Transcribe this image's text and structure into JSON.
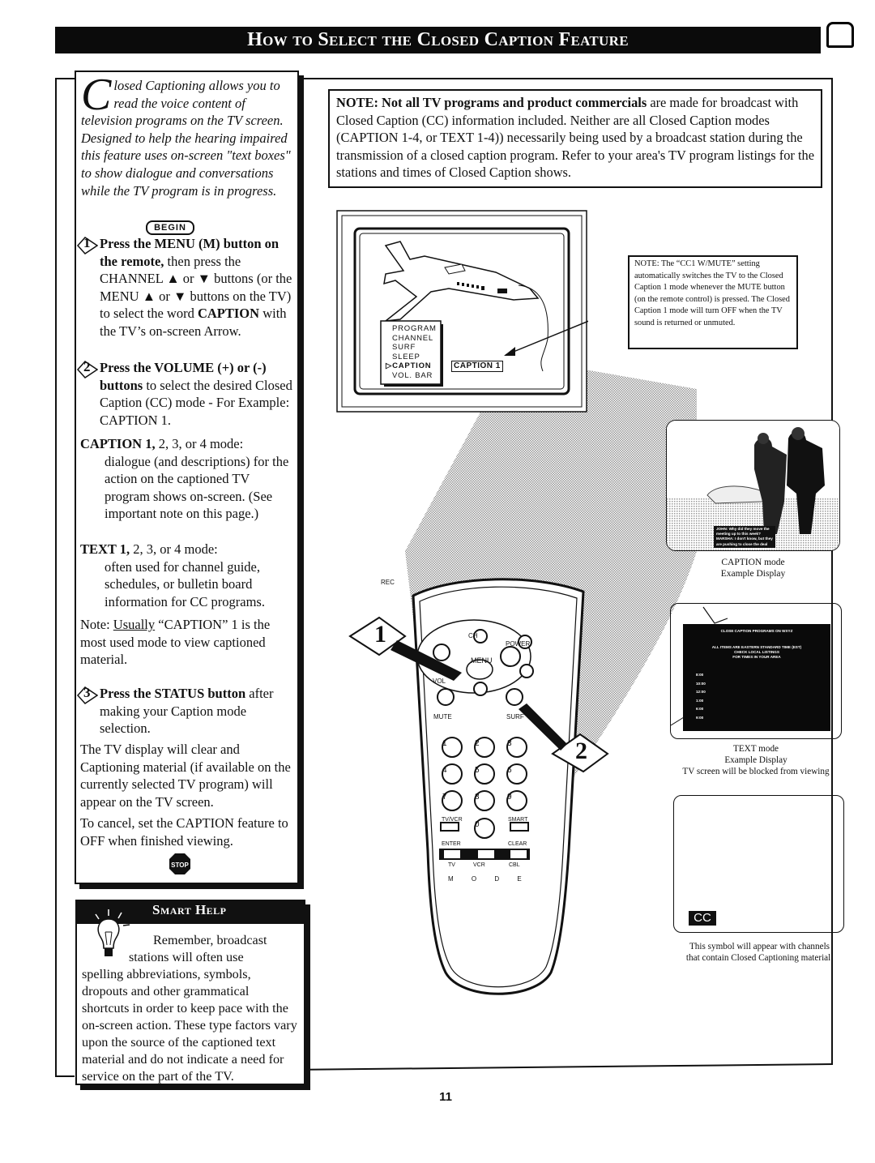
{
  "header": {
    "title": "How to Select the Closed Caption Feature",
    "icon": "tv-icon"
  },
  "intro": {
    "dropcap": "C",
    "text": "losed Captioning allows you to read the voice content of television programs on the TV screen. Designed to help the hearing impaired this feature uses on-screen \"text boxes\" to show dialogue and conversations while the TV program is in progress."
  },
  "begin_label": "BEGIN",
  "steps": [
    {
      "number": "1",
      "bold": "Press the MENU (M) button on the remote,",
      "text": " then press the CHANNEL ▲ or ▼ buttons (or the MENU ▲ or ▼ buttons on the TV) to select the word ",
      "bold2": "CAPTION",
      "text2": " with the TV’s on-screen Arrow."
    },
    {
      "number": "2",
      "bold": "Press the VOLUME (+) or (-) buttons",
      "text": " to select the desired Closed Caption (CC) mode - For Example: CAPTION 1."
    },
    {
      "number": "3",
      "bold": "Press the STATUS button",
      "text": " after making your Caption mode selection."
    }
  ],
  "modes": {
    "caption": {
      "title_bold": "CAPTION 1,",
      "title_rest": " 2, 3, or 4 mode:",
      "desc": "dialogue (and descriptions) for the action on the captioned TV program shows on-screen. (See important note on this page.)"
    },
    "text": {
      "title_bold": "TEXT 1,",
      "title_rest": " 2, 3, or 4 mode:",
      "desc": "often used for channel guide, schedules, or bulletin board information for CC programs."
    }
  },
  "usual_note": {
    "prefix": "Note: ",
    "underlined": "Usually",
    "rest": " “CAPTION” 1 is the most used mode to view captioned material."
  },
  "clear_note": "The TV display will clear and Captioning material  (if available on the currently selected TV program) will appear on the TV screen.",
  "cancel_note": "To cancel, set the CAPTION feature to OFF when finished viewing.",
  "stop_label": "STOP",
  "smart_help": {
    "title": "Smart Help",
    "line1": "Remember, broadcast",
    "line2": "stations will often use",
    "rest": "spelling abbreviations, symbols, dropouts and other grammatical shortcuts in order to keep pace with the on-screen action. These type factors vary upon the source of the captioned text material and do not indicate a need for service on the part of the TV."
  },
  "note_box": {
    "bold": "NOTE: Not all TV programs and product commercials",
    "text": " are made for broadcast with Closed Caption (CC) information included. Neither are all Closed Caption modes (CAPTION 1-4, or TEXT 1-4)) necessarily being used by a broadcast station during the transmission of a closed caption program. Refer to your area's TV program listings for the stations and times of Closed Caption shows."
  },
  "tv_menu": {
    "items": [
      "PROGRAM",
      "CHANNEL",
      "SURF",
      "SLEEP",
      "CAPTION",
      "VOL. BAR"
    ],
    "selected_index": 4,
    "caption_value": "CAPTION 1"
  },
  "mute_note": "NOTE: The “CC1 W/MUTE” setting automatically switches the TV to the Closed Caption 1 mode whenever the MUTE button (on the remote control) is pressed. The Closed Caption 1 mode will turn OFF when the TV sound is returned or unmuted.",
  "caption_example": {
    "subtitle_lines": [
      "JOHN: Why did they move the",
      "meeting up to this week?",
      "MARSHA: I don't know, but they",
      "are pushing to close the deal"
    ],
    "label_line1": "CAPTION mode",
    "label_line2": "Example Display"
  },
  "text_example": {
    "heading": "CLOSE CAPTION PROGRAMS ON WXYZ",
    "sub1": "ALL ITEMS ARE EASTERN STANDARD TIME (EST)",
    "sub2": "CHECK LOCAL LISTINGS",
    "sub3": "FOR TIMES IN YOUR AREA",
    "times": [
      "8:00",
      "10:00",
      "12:00",
      "1:00",
      "6:00",
      "9:00"
    ],
    "label_line1": "TEXT mode",
    "label_line2": "Example Display",
    "label_line3": "TV screen will be blocked from viewing"
  },
  "cc_example": {
    "badge": "CC",
    "label_line1": "This symbol will appear with channels",
    "label_line2": "that contain Closed Captioning material."
  },
  "remote": {
    "labels": {
      "rec": "REC",
      "power": "POWER",
      "ch": "CH",
      "menu": "MENU",
      "vol": "VOL",
      "mute": "MUTE",
      "surf": "SURF",
      "tvvcr": "TV/VCR",
      "enter": "ENTER",
      "smart": "SMART",
      "clear": "CLEAR",
      "tv": "TV",
      "vcr": "VCR",
      "cbl": "CBL",
      "mode": "M O D E"
    },
    "digits": [
      "1",
      "2",
      "3",
      "4",
      "5",
      "6",
      "7",
      "8",
      "9",
      "0"
    ],
    "callouts": [
      "1",
      "2"
    ]
  },
  "page_number": "11"
}
